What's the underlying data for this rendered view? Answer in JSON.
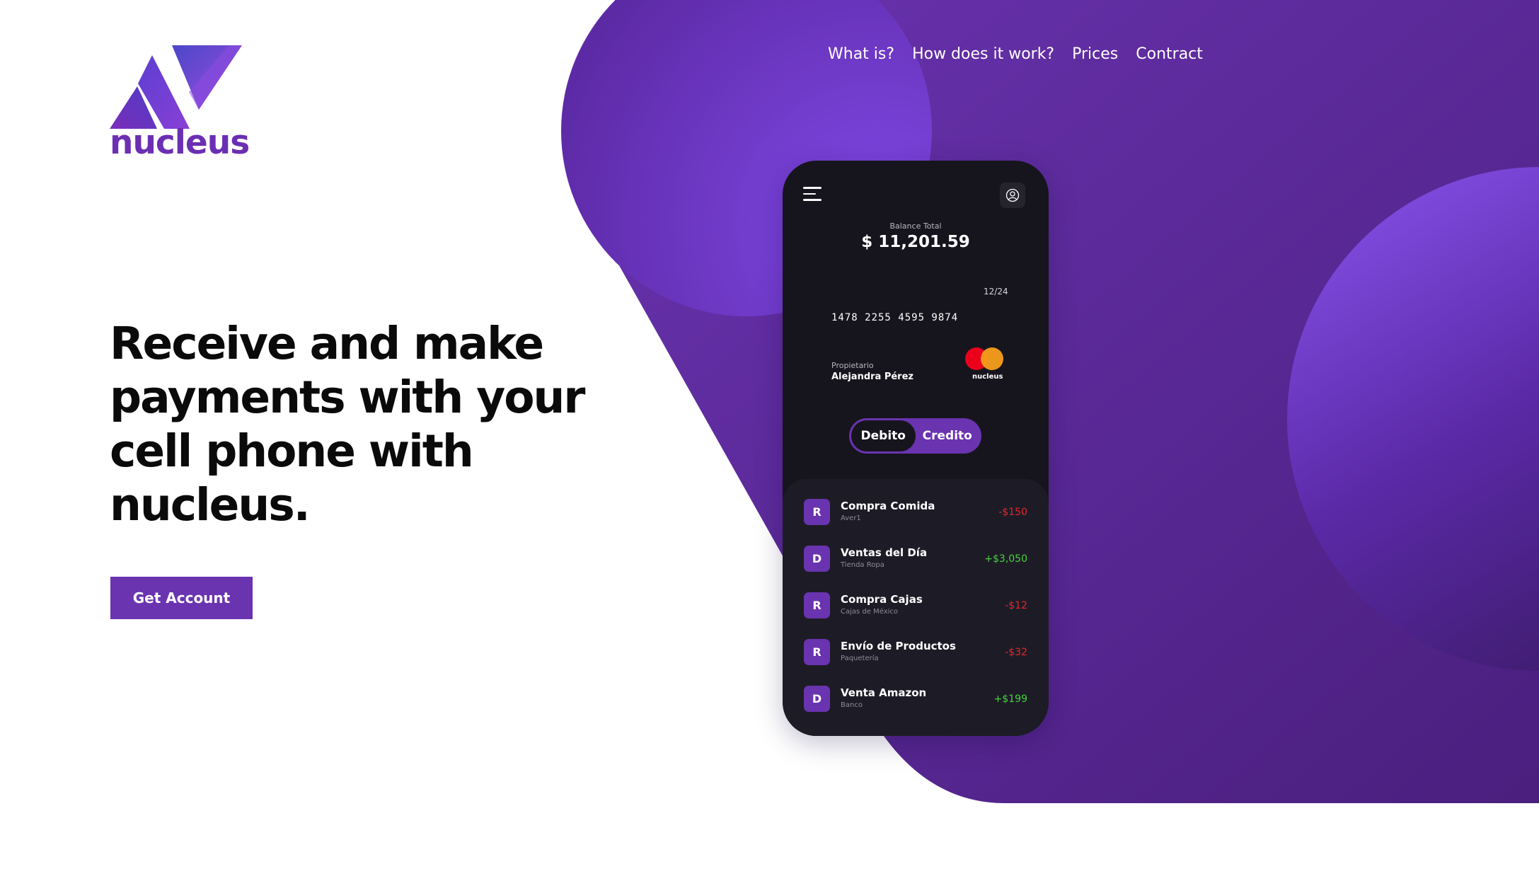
{
  "brand": {
    "name": "nucleus",
    "primary_color": "#6a33b0",
    "accent_color": "#7c4ce0"
  },
  "nav": {
    "items": [
      "What is?",
      "How does it work?",
      "Prices",
      "Contract"
    ]
  },
  "hero": {
    "headline": "Receive and make payments with your cell phone with nucleus.",
    "cta_label": "Get Account"
  },
  "phone": {
    "balance_label": "Balance Total",
    "balance_value": "$ 11,201.59",
    "card": {
      "expiry": "12/24",
      "number": "1478 2255 4595 9874",
      "owner_label": "Propietario",
      "owner_name": "Alejandra Pérez",
      "brand_label": "nucleus"
    },
    "toggle": {
      "options": [
        "Debito",
        "Credito"
      ],
      "selected": "Debito"
    },
    "transactions": [
      {
        "initial": "R",
        "title": "Compra Comida",
        "subtitle": "Aver1",
        "amount": "-$150",
        "type": "negative"
      },
      {
        "initial": "D",
        "title": "Ventas del Día",
        "subtitle": "Tienda Ropa",
        "amount": "+$3,050",
        "type": "positive"
      },
      {
        "initial": "R",
        "title": "Compra Cajas",
        "subtitle": "Cajas de México",
        "amount": "-$12",
        "type": "negative"
      },
      {
        "initial": "R",
        "title": "Envío de Productos",
        "subtitle": "Paquetería",
        "amount": "-$32",
        "type": "negative"
      },
      {
        "initial": "D",
        "title": "Venta Amazon",
        "subtitle": "Banco",
        "amount": "+$199",
        "type": "positive"
      }
    ]
  },
  "icons": {
    "menu": "hamburger-icon",
    "profile": "user-circle-icon"
  }
}
